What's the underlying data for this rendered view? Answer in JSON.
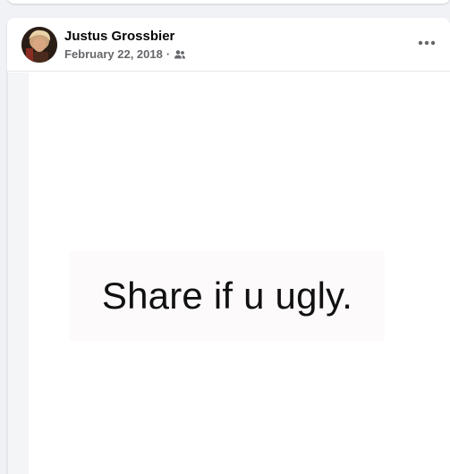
{
  "post": {
    "author_name": "Justus Grossbier",
    "date": "February 22, 2018",
    "separator": "·",
    "audience_icon": "friends-icon",
    "more_icon": "more-options-icon"
  },
  "media": {
    "text": "Share if u ugly."
  },
  "colors": {
    "background": "#f0f2f5",
    "card": "#ffffff",
    "name_text": "#050505",
    "meta_text": "#65676b"
  }
}
